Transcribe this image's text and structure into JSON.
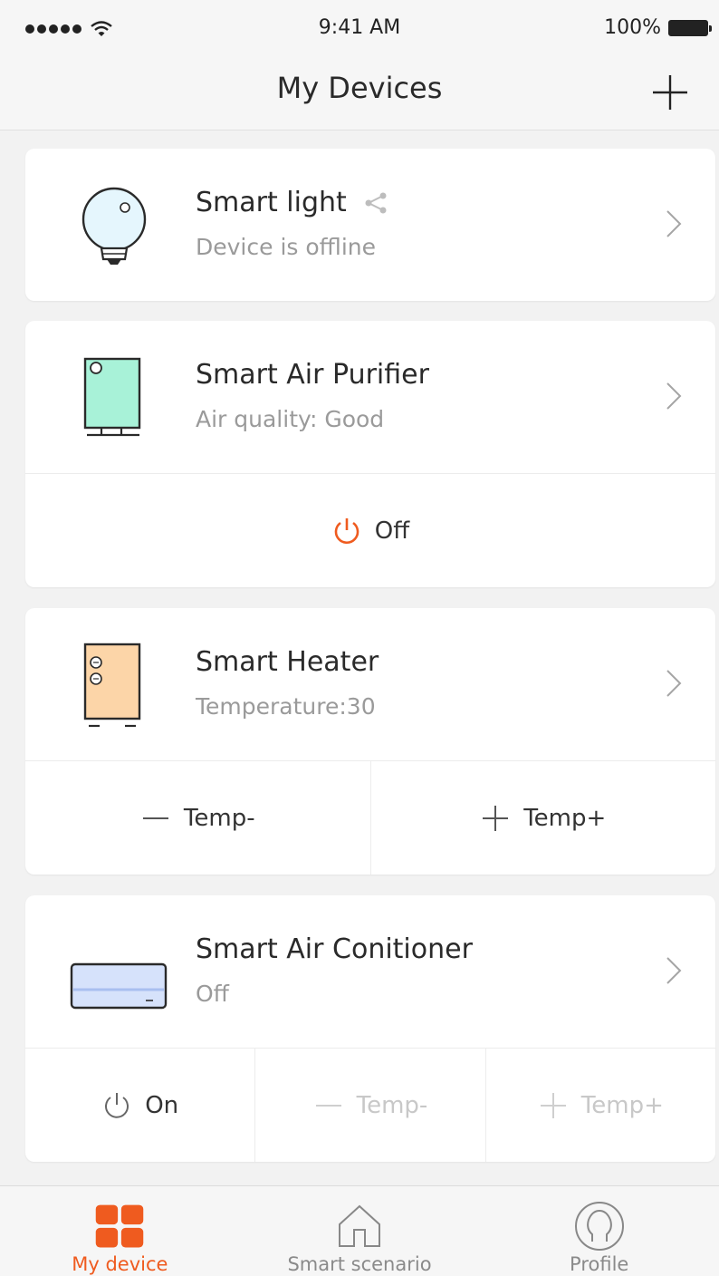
{
  "status_bar": {
    "time": "9:41 AM",
    "battery": "100%"
  },
  "header": {
    "title": "My Devices",
    "add_icon": "plus-icon"
  },
  "devices": [
    {
      "name": "Smart light",
      "status": "Device is offline",
      "icon": "light-bulb-icon",
      "shared": true
    },
    {
      "name": "Smart Air Purifier",
      "status": "Air quality: Good",
      "icon": "air-purifier-icon",
      "actions": [
        {
          "label": "Off",
          "icon": "power-icon",
          "enabled": true
        }
      ]
    },
    {
      "name": "Smart Heater",
      "status": "Temperature:30",
      "icon": "heater-icon",
      "actions": [
        {
          "label": "Temp-",
          "icon": "minus-icon",
          "enabled": true
        },
        {
          "label": "Temp+",
          "icon": "plus-icon",
          "enabled": true
        }
      ]
    },
    {
      "name": "Smart Air Conitioner",
      "status": "Off",
      "icon": "air-conditioner-icon",
      "actions": [
        {
          "label": "On",
          "icon": "power-icon",
          "enabled": true
        },
        {
          "label": "Temp-",
          "icon": "minus-icon",
          "enabled": false
        },
        {
          "label": "Temp+",
          "icon": "plus-icon",
          "enabled": false
        }
      ]
    }
  ],
  "tabs": [
    {
      "label": "My device",
      "icon": "grid-icon",
      "active": true
    },
    {
      "label": "Smart scenario",
      "icon": "home-icon",
      "active": false
    },
    {
      "label": "Profile",
      "icon": "profile-icon",
      "active": false
    }
  ],
  "colors": {
    "accent": "#ef5b1f",
    "purifier_screen": "#a8f2d8",
    "heater_panel": "#fcd5a8",
    "ac_panel": "#d6e2fb"
  }
}
